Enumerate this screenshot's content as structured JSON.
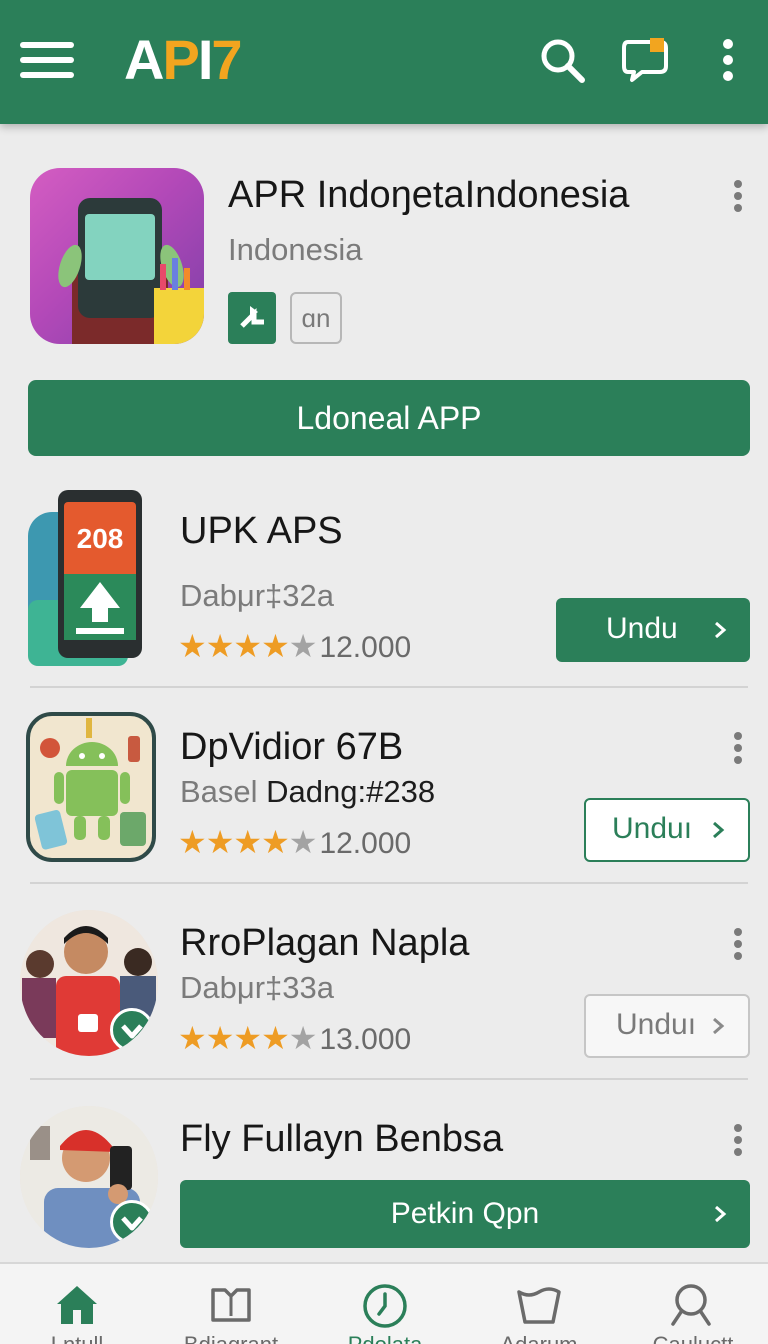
{
  "header": {
    "logo": {
      "part1": "A",
      "part2": "P",
      "part3": "I",
      "part4": "7"
    },
    "icons": [
      "menu-icon",
      "search-icon",
      "chat-icon",
      "more-vertical-icon"
    ]
  },
  "featured": {
    "title": "APR IndoŋetaIndonesia",
    "subtitle": "Indonesia",
    "badge_text": "ɑn",
    "cta_label": "Ldoneal APP"
  },
  "apps": [
    {
      "title": "UPK APS",
      "meta": "Dabμr‡32a",
      "rating": "12.000",
      "stars_filled": 4,
      "button_label": "Undu",
      "button_style": "filled",
      "icon_number": "208"
    },
    {
      "title": "DpVidior 67B",
      "meta_prefix": "Basel",
      "meta_strong": "Dadng:#238",
      "rating": "12.000",
      "stars_filled": 4,
      "button_label": "Unduı",
      "button_style": "outline-green"
    },
    {
      "title": "RroPlagan Napla",
      "meta": "Dabμr‡33a",
      "rating": "13.000",
      "stars_filled": 4,
      "button_label": "Unduı",
      "button_style": "outline-grey"
    },
    {
      "title": "Fly Fullayn Benbsa",
      "button_label": "Petkin Qpn",
      "button_style": "filled-wide"
    }
  ],
  "bottom_nav": [
    {
      "label": "Lntull",
      "icon": "home-icon",
      "active": false
    },
    {
      "label": "Bdiagrant",
      "icon": "book-icon",
      "active": false
    },
    {
      "label": "Pdolata",
      "icon": "clock-icon",
      "active": true
    },
    {
      "label": "Adarum",
      "icon": "bag-icon",
      "active": false
    },
    {
      "label": "Cauluctt",
      "icon": "search-icon",
      "active": false
    }
  ],
  "colors": {
    "primary": "#2b7f59",
    "accent": "#f2a51f",
    "star": "#ee9c24",
    "background": "#ececec"
  }
}
